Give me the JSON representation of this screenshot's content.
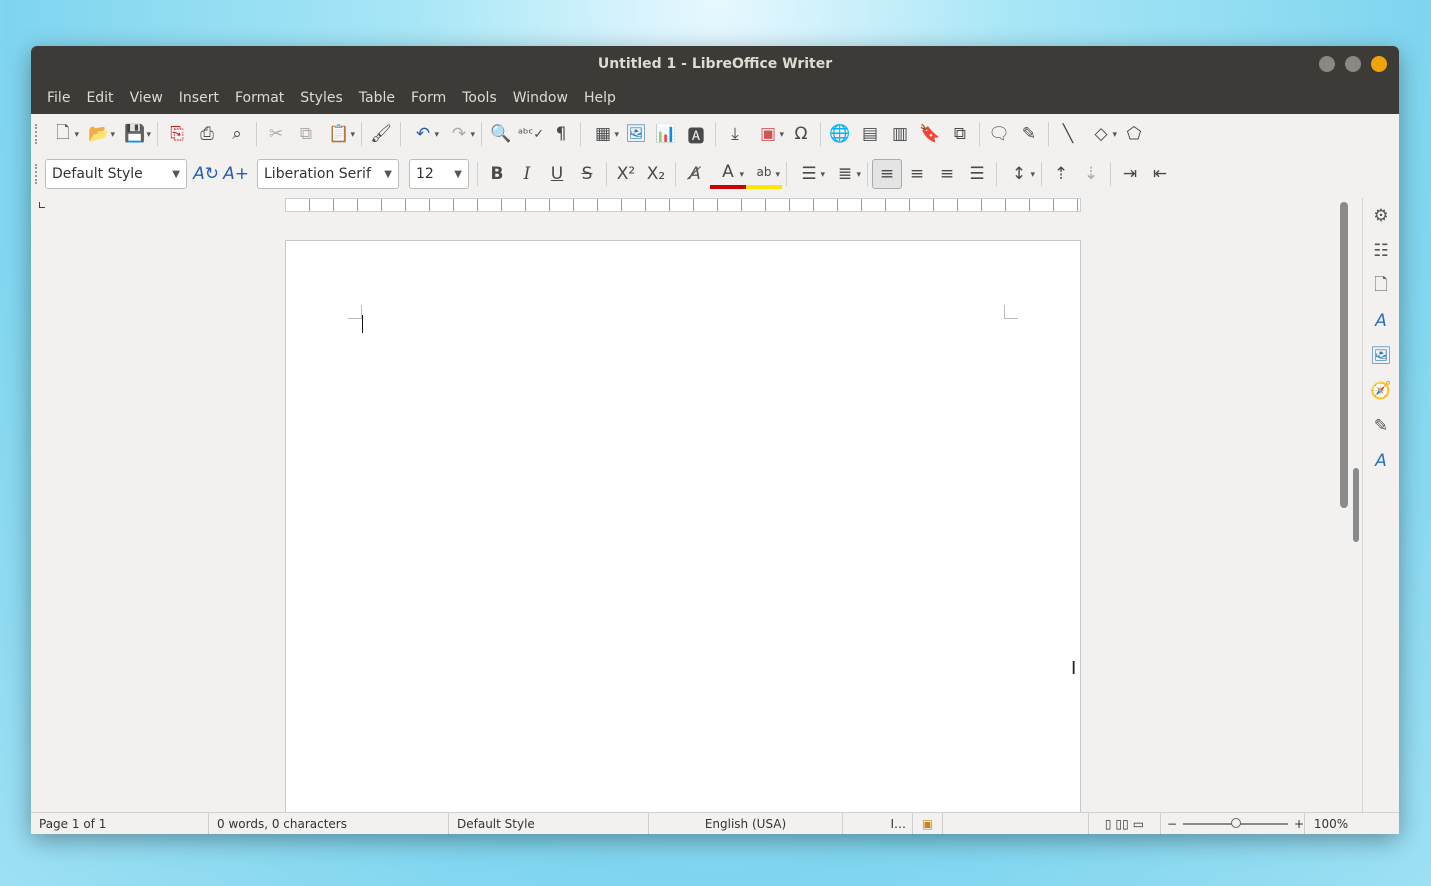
{
  "window": {
    "title": "Untitled 1 - LibreOffice Writer"
  },
  "menubar": {
    "items": [
      "File",
      "Edit",
      "View",
      "Insert",
      "Format",
      "Styles",
      "Table",
      "Form",
      "Tools",
      "Window",
      "Help"
    ]
  },
  "formatting": {
    "paragraph_style": "Default Style",
    "font_name": "Liberation Serif",
    "font_size": "12",
    "superscript_glyph": "X²",
    "subscript_glyph": "X₂"
  },
  "statusbar": {
    "page": "Page 1 of 1",
    "word_count": "0 words, 0 characters",
    "page_style": "Default Style",
    "language": "English (USA)",
    "zoom": "100%",
    "zoom_minus": "−",
    "zoom_plus": "+"
  },
  "colors": {
    "font_color": "#cc0000",
    "highlight_color": "#ffe500",
    "close_button": "#f0a30a"
  },
  "icons": {
    "standard": [
      "new-document-icon",
      "open-icon",
      "save-icon",
      "export-pdf-icon",
      "print-icon",
      "print-preview-icon",
      "cut-icon",
      "copy-icon",
      "paste-icon",
      "clone-formatting-icon",
      "undo-icon",
      "redo-icon",
      "find-replace-icon",
      "spelling-icon",
      "formatting-marks-icon",
      "table-icon",
      "image-icon",
      "chart-icon",
      "text-box-icon",
      "page-break-icon",
      "field-icon",
      "special-character-icon",
      "hyperlink-icon",
      "footnote-icon",
      "endnote-icon",
      "bookmark-icon",
      "cross-reference-icon",
      "comment-icon",
      "track-changes-icon",
      "line-icon",
      "shapes-icon",
      "draw-functions-icon"
    ],
    "sidebar": [
      "properties-icon",
      "styles-icon",
      "page-icon",
      "style-inspector-icon",
      "gallery-icon",
      "navigator-icon",
      "manage-changes-icon",
      "design-icon"
    ]
  }
}
